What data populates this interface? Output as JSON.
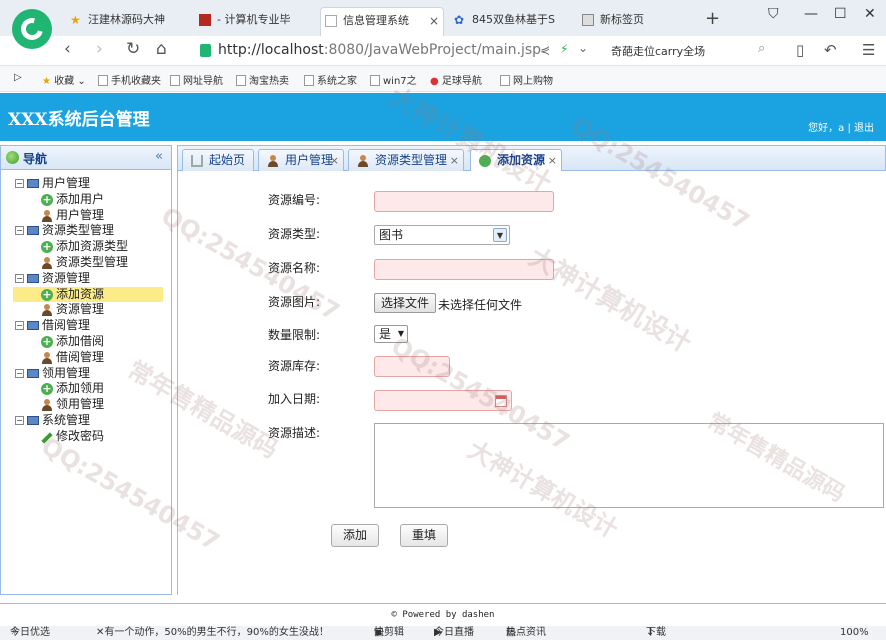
{
  "browser": {
    "tabs": [
      {
        "title": "汪建林源码大神",
        "active": false
      },
      {
        "title": "- 计算机专业毕",
        "active": false
      },
      {
        "title": "信息管理系统",
        "active": true
      },
      {
        "title": "845双鱼林基于S",
        "active": false
      },
      {
        "title": "新标签页",
        "active": false
      }
    ],
    "url_host": "http://localhost",
    "url_path": ":8080/JavaWebProject/main.jsp",
    "url_right_text": "奇葩走位carry全场",
    "bookmarks": [
      "收藏",
      "手机收藏夹",
      "网址导航",
      "淘宝热卖",
      "系统之家",
      "win7之",
      "足球导航",
      "网上购物"
    ]
  },
  "app": {
    "title": "XXX系统后台管理",
    "user_text": "您好，a  |  退出",
    "nav_title": "导航",
    "nav_collapse": "«",
    "tree": [
      {
        "label": "用户管理",
        "type": "parent",
        "exp": "−"
      },
      {
        "label": "添加用户",
        "type": "add"
      },
      {
        "label": "用户管理",
        "type": "person"
      },
      {
        "label": "资源类型管理",
        "type": "parent",
        "exp": "−"
      },
      {
        "label": "添加资源类型",
        "type": "add"
      },
      {
        "label": "资源类型管理",
        "type": "person"
      },
      {
        "label": "资源管理",
        "type": "parent",
        "exp": "−"
      },
      {
        "label": "添加资源",
        "type": "add",
        "selected": true
      },
      {
        "label": "资源管理",
        "type": "person"
      },
      {
        "label": "借阅管理",
        "type": "parent",
        "exp": "−"
      },
      {
        "label": "添加借阅",
        "type": "add"
      },
      {
        "label": "借阅管理",
        "type": "person"
      },
      {
        "label": "领用管理",
        "type": "parent",
        "exp": "−"
      },
      {
        "label": "添加领用",
        "type": "add"
      },
      {
        "label": "领用管理",
        "type": "person"
      },
      {
        "label": "系统管理",
        "type": "parent",
        "exp": "−"
      },
      {
        "label": "修改密码",
        "type": "edit"
      }
    ],
    "tabs": [
      {
        "label": "起始页",
        "closable": false
      },
      {
        "label": "用户管理",
        "closable": true
      },
      {
        "label": "资源类型管理",
        "closable": true
      },
      {
        "label": "添加资源",
        "closable": true,
        "active": true
      }
    ],
    "tab_close": "×"
  },
  "form": {
    "code_label": "资源编号:",
    "type_label": "资源类型:",
    "type_value": "图书",
    "name_label": "资源名称:",
    "image_label": "资源图片:",
    "file_button": "选择文件",
    "file_status": "未选择任何文件",
    "limit_label": "数量限制:",
    "limit_value": "是",
    "stock_label": "资源库存:",
    "date_label": "加入日期:",
    "desc_label": "资源描述:",
    "submit": "添加",
    "reset": "重填"
  },
  "footer": "© Powered by dashen",
  "statusbar": {
    "left": "今日优选",
    "news": "有一个动作，50%的男生不行，90%的女生没战！",
    "items": [
      "快剪辑",
      "今日直播",
      "热点资讯",
      "下载"
    ],
    "zoom": "100%"
  },
  "watermark": [
    "大神计算机设计",
    "QQ:254540457",
    "常年售精品源码"
  ]
}
